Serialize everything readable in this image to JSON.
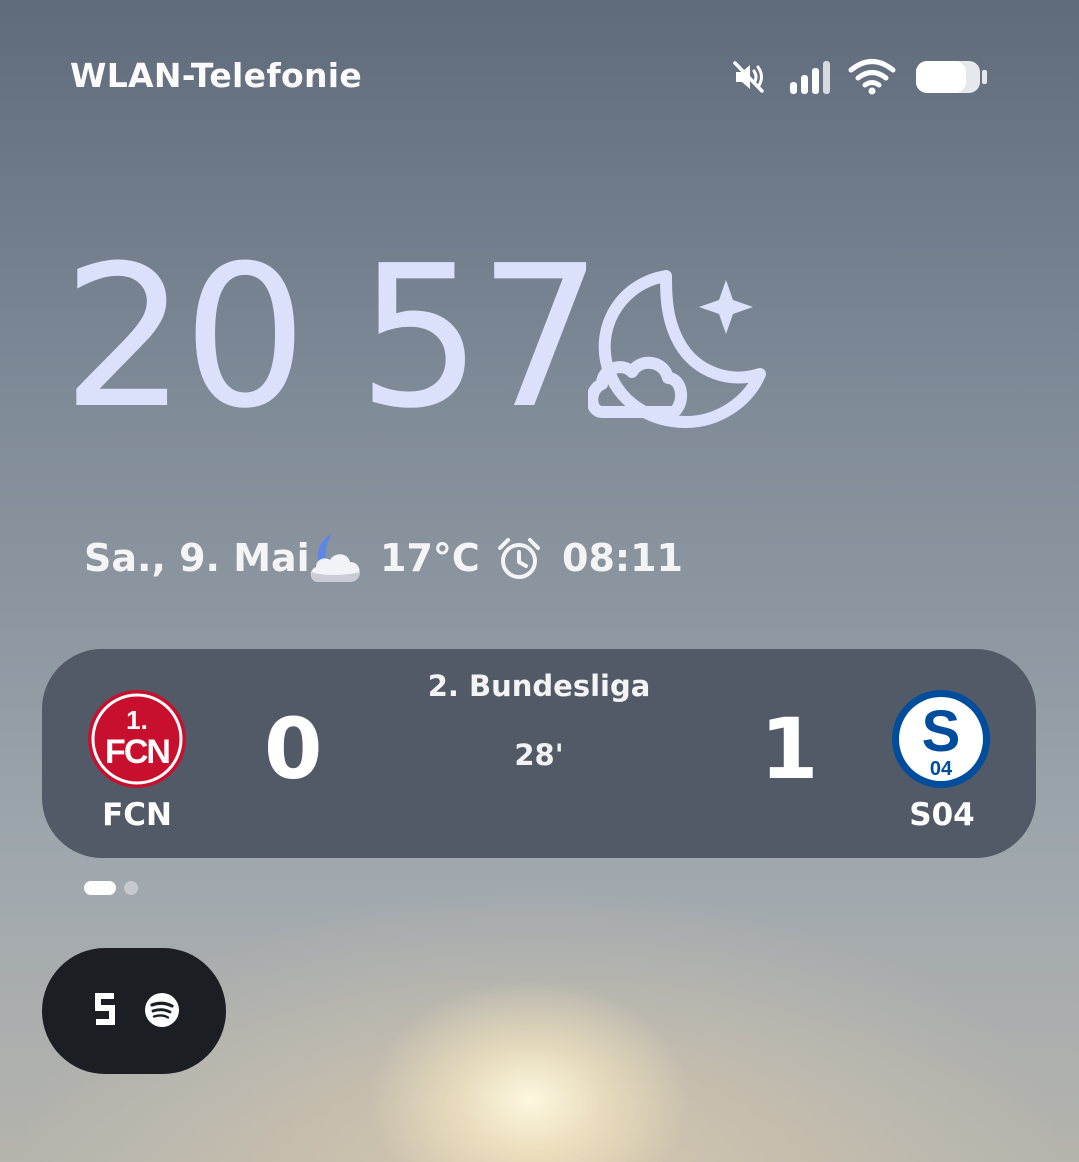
{
  "status_bar": {
    "carrier": "WLAN-Telefonie",
    "icons": [
      "mute-icon",
      "signal-icon",
      "wifi-icon",
      "battery-icon"
    ]
  },
  "lock_clock": {
    "hours": "20",
    "minutes": "57",
    "weather_icon": "moon-cloud-star-icon",
    "color": "#dbe1fb"
  },
  "info_line": {
    "date": "Sa., 9. Mai",
    "weather_icon": "moon-cloud-icon",
    "temperature": "17°C",
    "alarm_icon": "alarm-clock-icon",
    "alarm_time": "08:11"
  },
  "live_score": {
    "league": "2. Bundesliga",
    "minute": "28'",
    "home": {
      "abbr": "FCN",
      "score": "0",
      "crest_color": "#c8102e"
    },
    "away": {
      "abbr": "S04",
      "score": "1",
      "crest_color": "#004d9d"
    },
    "pages": 2,
    "active_page": 1
  },
  "media_pill": {
    "icons": [
      "app-s-icon",
      "spotify-icon"
    ]
  }
}
